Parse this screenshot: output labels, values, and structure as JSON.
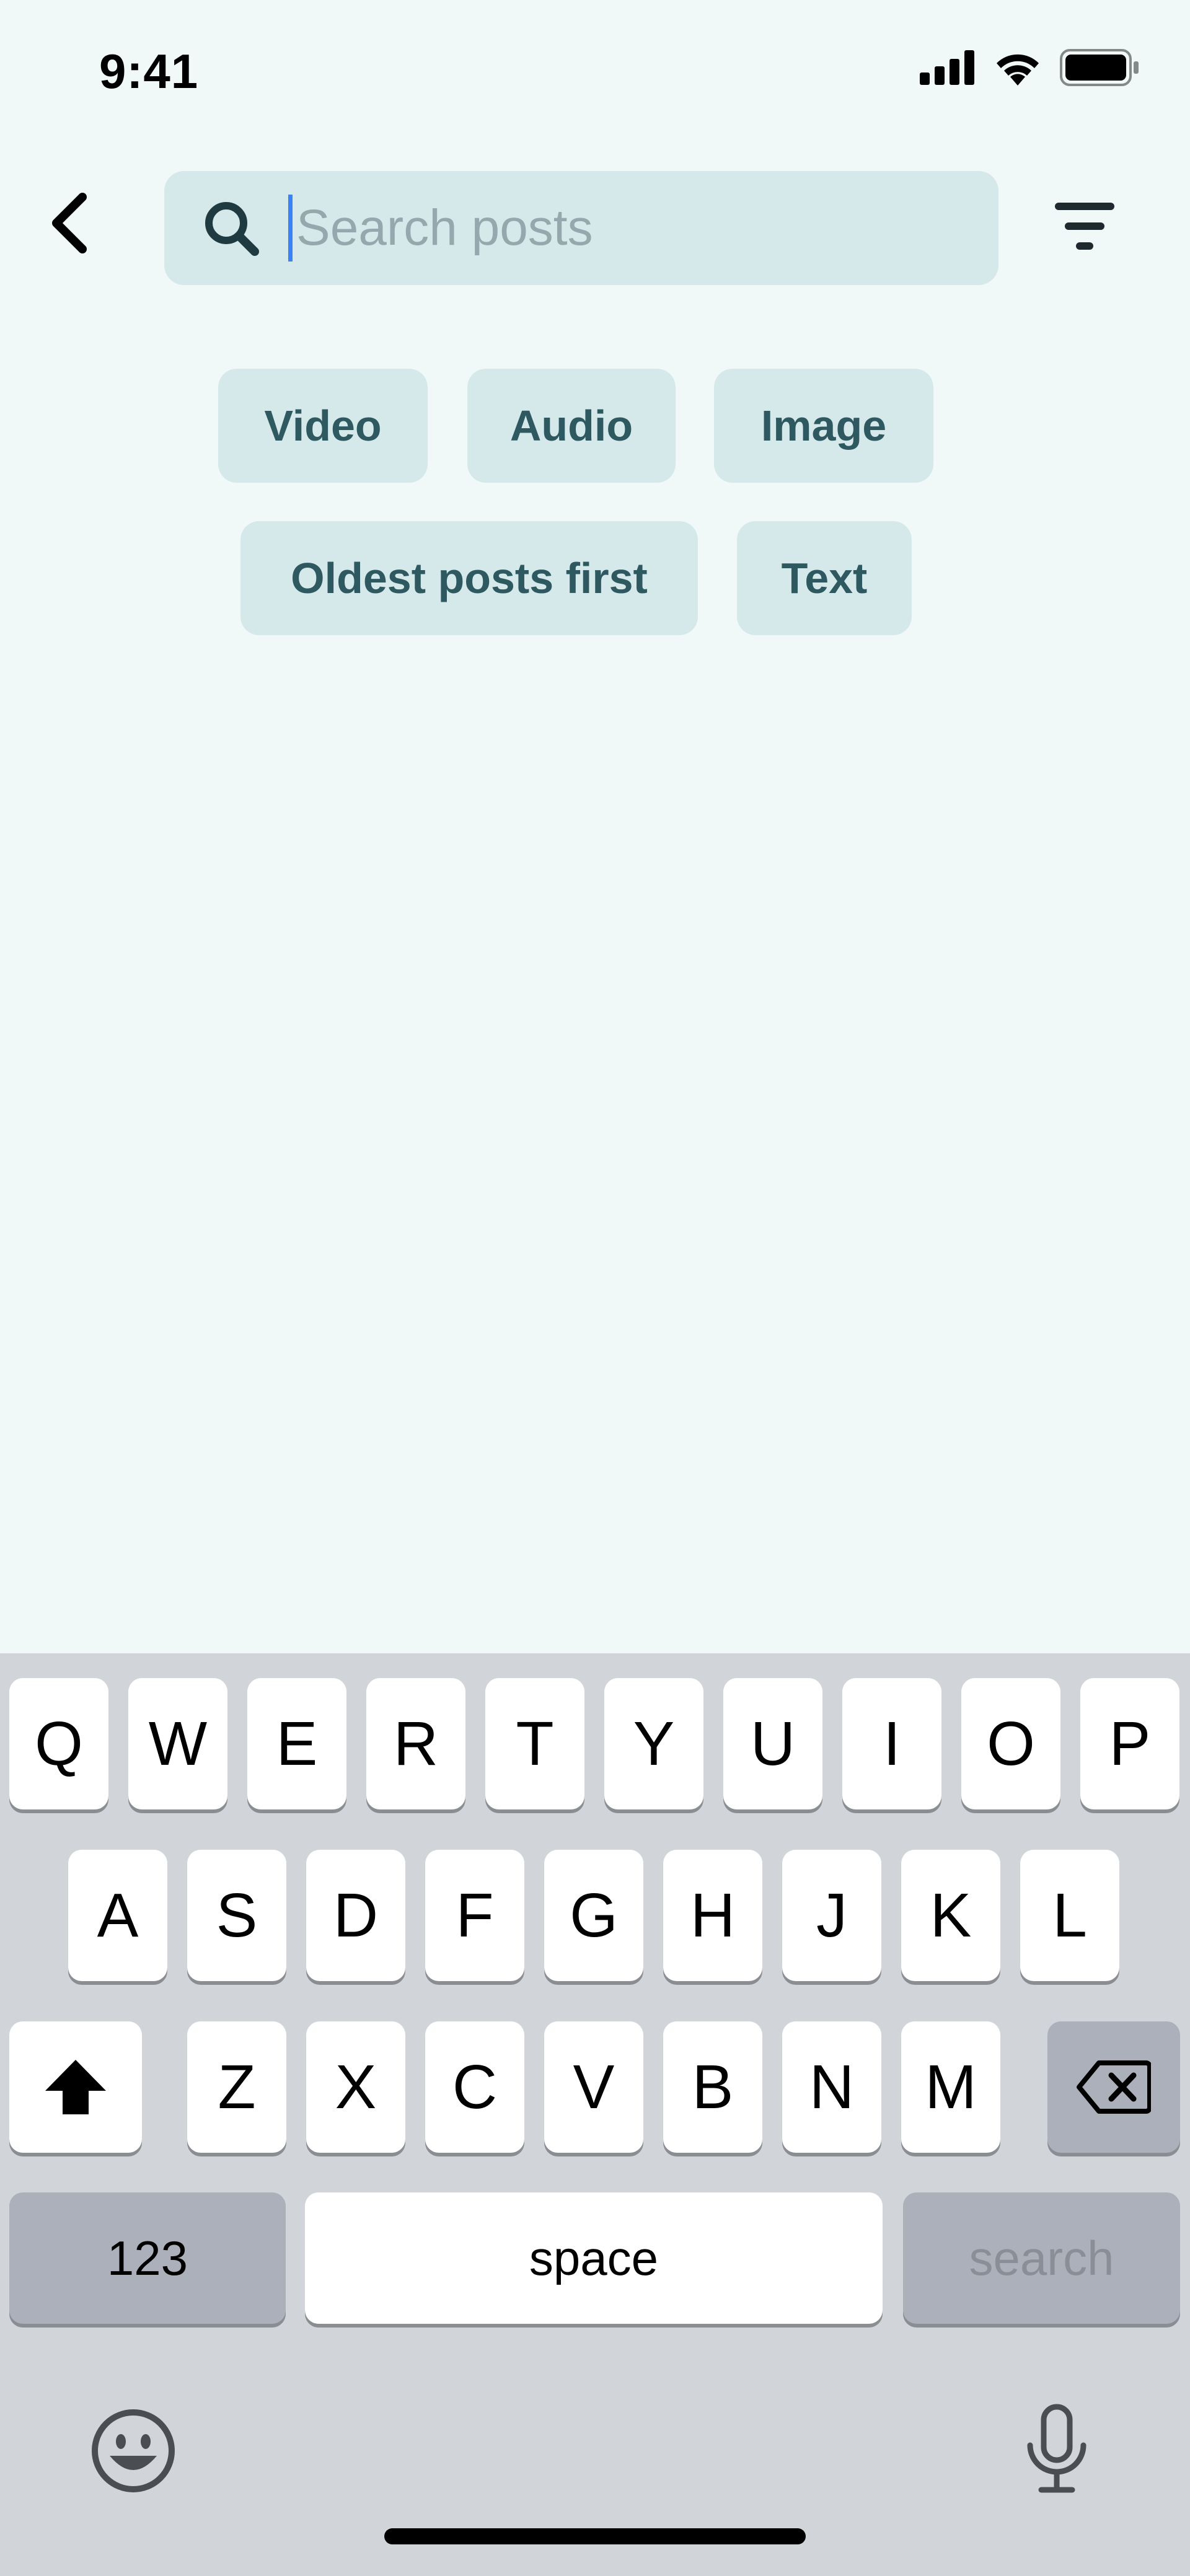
{
  "status_bar": {
    "time": "9:41"
  },
  "search": {
    "placeholder": "Search posts",
    "value": ""
  },
  "chips": [
    {
      "label": "Video"
    },
    {
      "label": "Audio"
    },
    {
      "label": "Image"
    },
    {
      "label": "Oldest posts first"
    },
    {
      "label": "Text"
    }
  ],
  "keyboard": {
    "row1": [
      "Q",
      "W",
      "E",
      "R",
      "T",
      "Y",
      "U",
      "I",
      "O",
      "P"
    ],
    "row2": [
      "A",
      "S",
      "D",
      "F",
      "G",
      "H",
      "J",
      "K",
      "L"
    ],
    "row3": [
      "Z",
      "X",
      "C",
      "V",
      "B",
      "N",
      "M"
    ],
    "numbers_label": "123",
    "space_label": "space",
    "search_label": "search"
  },
  "colors": {
    "background": "#F0F9F8",
    "chip_bg": "#D6E9EA",
    "chip_text": "#2F5960",
    "caret": "#3B82F6",
    "keyboard_bg": "#D1D4D9"
  },
  "icons": [
    "back-chevron-icon",
    "search-icon",
    "filter-icon",
    "signal-icon",
    "wifi-icon",
    "battery-icon",
    "shift-icon",
    "backspace-icon",
    "emoji-icon",
    "microphone-icon"
  ]
}
